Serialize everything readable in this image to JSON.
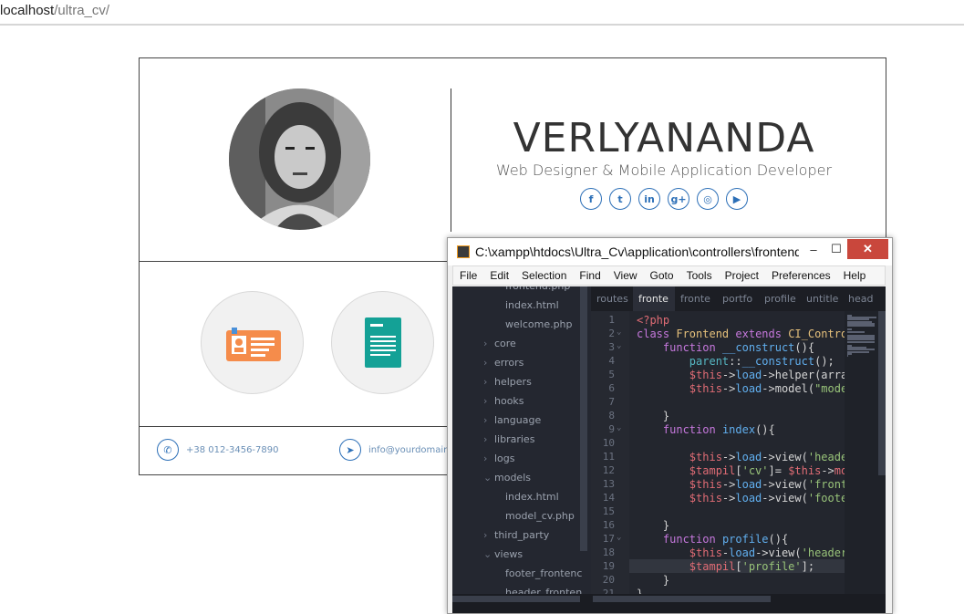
{
  "browser": {
    "url_host": "localhost",
    "url_path": "/ultra_cv/"
  },
  "cv": {
    "name": "VERLYANANDA",
    "role": "Web Designer & Mobile Application Developer",
    "socials": [
      {
        "icon": "facebook-icon",
        "glyph": "f"
      },
      {
        "icon": "twitter-icon",
        "glyph": "t"
      },
      {
        "icon": "linkedin-icon",
        "glyph": "in"
      },
      {
        "icon": "google-plus-icon",
        "glyph": "g+"
      },
      {
        "icon": "dribbble-icon",
        "glyph": "◎"
      },
      {
        "icon": "youtube-icon",
        "glyph": "▶"
      }
    ],
    "phone": "+38 012-3456-7890",
    "email": "info@yourdomain"
  },
  "editor": {
    "title": "C:\\xampp\\htdocs\\Ultra_Cv\\application\\controllers\\frontend.php",
    "window_buttons": {
      "minimize": "–",
      "maximize": "☐",
      "close": "✕"
    },
    "menu": [
      "File",
      "Edit",
      "Selection",
      "Find",
      "View",
      "Goto",
      "Tools",
      "Project",
      "Preferences",
      "Help"
    ],
    "sidebar": [
      {
        "label": "frontend.php",
        "indent": 2,
        "chev": ""
      },
      {
        "label": "index.html",
        "indent": 2,
        "chev": ""
      },
      {
        "label": "welcome.php",
        "indent": 2,
        "chev": ""
      },
      {
        "label": "core",
        "indent": 1,
        "chev": "›"
      },
      {
        "label": "errors",
        "indent": 1,
        "chev": "›"
      },
      {
        "label": "helpers",
        "indent": 1,
        "chev": "›"
      },
      {
        "label": "hooks",
        "indent": 1,
        "chev": "›"
      },
      {
        "label": "language",
        "indent": 1,
        "chev": "›"
      },
      {
        "label": "libraries",
        "indent": 1,
        "chev": "›"
      },
      {
        "label": "logs",
        "indent": 1,
        "chev": "›"
      },
      {
        "label": "models",
        "indent": 1,
        "chev": "⌄"
      },
      {
        "label": "index.html",
        "indent": 2,
        "chev": ""
      },
      {
        "label": "model_cv.php",
        "indent": 2,
        "chev": ""
      },
      {
        "label": "third_party",
        "indent": 1,
        "chev": "›"
      },
      {
        "label": "views",
        "indent": 1,
        "chev": "⌄"
      },
      {
        "label": "footer_frontenc",
        "indent": 2,
        "chev": ""
      },
      {
        "label": "header_fronten",
        "indent": 2,
        "chev": ""
      }
    ],
    "tabs": [
      {
        "label": "routes",
        "active": false
      },
      {
        "label": "fronte",
        "active": true
      },
      {
        "label": "fronte",
        "active": false
      },
      {
        "label": "portfo",
        "active": false
      },
      {
        "label": "profile",
        "active": false
      },
      {
        "label": "untitle",
        "active": false
      },
      {
        "label": "head",
        "active": false
      }
    ],
    "line_numbers": [
      "1",
      "2",
      "3",
      "4",
      "5",
      "6",
      "7",
      "8",
      "9",
      "10",
      "11",
      "12",
      "13",
      "14",
      "15",
      "16",
      "17",
      "18",
      "19",
      "20",
      "21"
    ],
    "fold_markers": {
      "2": "⌄",
      "3": "⌄",
      "9": "⌄",
      "17": "⌄"
    },
    "current_line": 19,
    "code_lines": [
      [
        [
          "v",
          "<?php"
        ]
      ],
      [
        [
          "k",
          "class "
        ],
        [
          "t",
          "Frontend "
        ],
        [
          "k",
          "extends "
        ],
        [
          "t",
          "CI_Controller"
        ]
      ],
      [
        [
          "",
          "    "
        ],
        [
          "k",
          "function "
        ],
        [
          "f",
          "__construct"
        ],
        [
          "",
          "(){"
        ]
      ],
      [
        [
          "",
          "        "
        ],
        [
          "o",
          "parent"
        ],
        [
          "",
          "::"
        ],
        [
          "f",
          "__construct"
        ],
        [
          "",
          "();"
        ]
      ],
      [
        [
          "",
          "        "
        ],
        [
          "v",
          "$this"
        ],
        [
          "",
          "->"
        ],
        [
          "f",
          "load"
        ],
        [
          "",
          "->helper(array"
        ]
      ],
      [
        [
          "",
          "        "
        ],
        [
          "v",
          "$this"
        ],
        [
          "",
          "->"
        ],
        [
          "f",
          "load"
        ],
        [
          "",
          "->model("
        ],
        [
          "s",
          "\"model"
        ]
      ],
      [
        [
          "",
          ""
        ]
      ],
      [
        [
          "",
          "    }"
        ]
      ],
      [
        [
          "",
          "    "
        ],
        [
          "k",
          "function "
        ],
        [
          "f",
          "index"
        ],
        [
          "",
          "(){"
        ]
      ],
      [
        [
          "",
          ""
        ]
      ],
      [
        [
          "",
          "        "
        ],
        [
          "v",
          "$this"
        ],
        [
          "",
          "->"
        ],
        [
          "f",
          "load"
        ],
        [
          "",
          "->view("
        ],
        [
          "s",
          "'header"
        ]
      ],
      [
        [
          "",
          "        "
        ],
        [
          "v",
          "$tampil"
        ],
        [
          "",
          "["
        ],
        [
          "s",
          "'cv'"
        ],
        [
          "",
          "]= "
        ],
        [
          "v",
          "$this"
        ],
        [
          "",
          "->"
        ],
        [
          "v",
          "mod"
        ]
      ],
      [
        [
          "",
          "        "
        ],
        [
          "v",
          "$this"
        ],
        [
          "",
          "->"
        ],
        [
          "f",
          "load"
        ],
        [
          "",
          "->view("
        ],
        [
          "s",
          "'fronte"
        ]
      ],
      [
        [
          "",
          "        "
        ],
        [
          "v",
          "$this"
        ],
        [
          "",
          "->"
        ],
        [
          "f",
          "load"
        ],
        [
          "",
          "->view("
        ],
        [
          "s",
          "'footer"
        ]
      ],
      [
        [
          "",
          ""
        ]
      ],
      [
        [
          "",
          "    }"
        ]
      ],
      [
        [
          "",
          "    "
        ],
        [
          "k",
          "function "
        ],
        [
          "f",
          "profile"
        ],
        [
          "",
          "(){"
        ]
      ],
      [
        [
          "",
          "        "
        ],
        [
          "v",
          "$this"
        ],
        [
          "",
          "-"
        ],
        [
          "f",
          "load"
        ],
        [
          "",
          "->view("
        ],
        [
          "s",
          "'header_"
        ]
      ],
      [
        [
          "",
          "        "
        ],
        [
          "v",
          "$tampil"
        ],
        [
          "",
          "["
        ],
        [
          "s",
          "'profile'"
        ],
        [
          "",
          "];"
        ]
      ],
      [
        [
          "",
          "    }"
        ]
      ],
      [
        [
          "",
          "}"
        ]
      ]
    ]
  }
}
